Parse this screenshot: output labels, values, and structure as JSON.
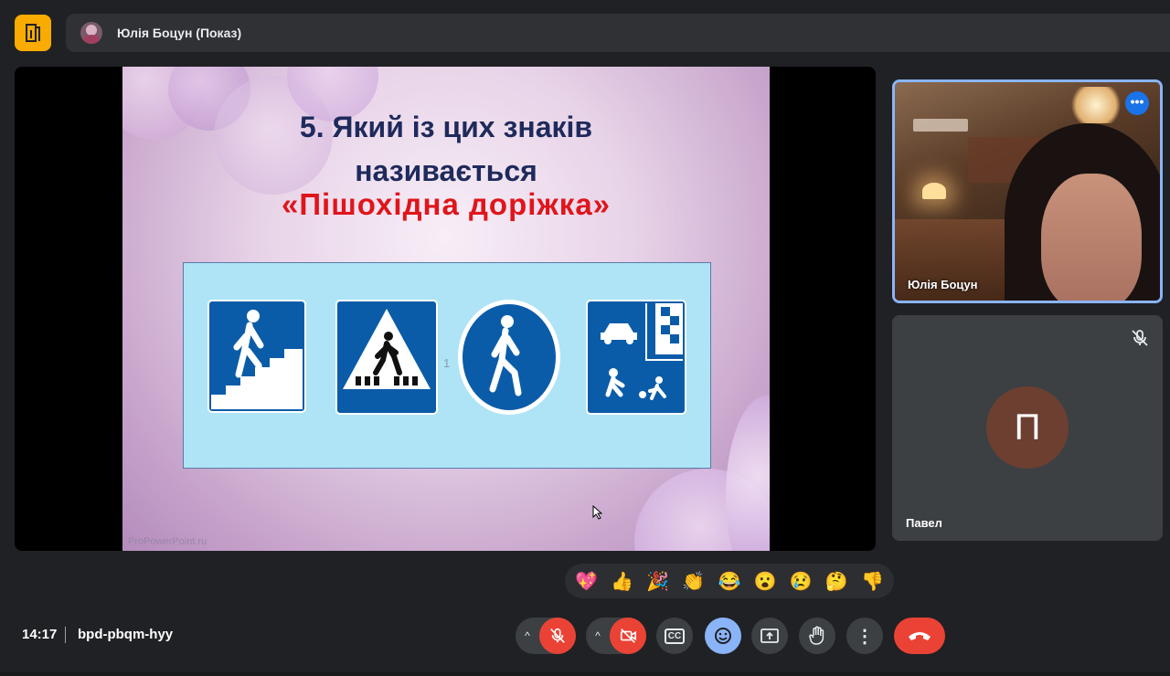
{
  "presenter": {
    "label": "Юлія Боцун (Показ)"
  },
  "slide": {
    "title_line1": "5. Який із цих знаків",
    "title_line2": "називається",
    "highlight": "«Пішохідна  доріжка»",
    "sign_number": "1",
    "watermark": "ProPowerPoint.ru"
  },
  "tiles": {
    "self_name": "Юлія Боцун",
    "more_label": "•••",
    "pavel_initial": "П",
    "pavel_name": "Павел"
  },
  "reactions": [
    "💖",
    "👍",
    "🎉",
    "👏",
    "😂",
    "😮",
    "😢",
    "🤔",
    "👎"
  ],
  "meeting": {
    "time": "14:17",
    "code": "bpd-pbqm-hyy"
  },
  "controls": {
    "chevron": "^",
    "cc_label": "CC",
    "more_label": "⋮"
  },
  "colors": {
    "accent_blue": "#8ab4f8",
    "danger_red": "#ea4335",
    "app_yellow": "#f9ab00",
    "sign_blue": "#0b5ca8"
  }
}
